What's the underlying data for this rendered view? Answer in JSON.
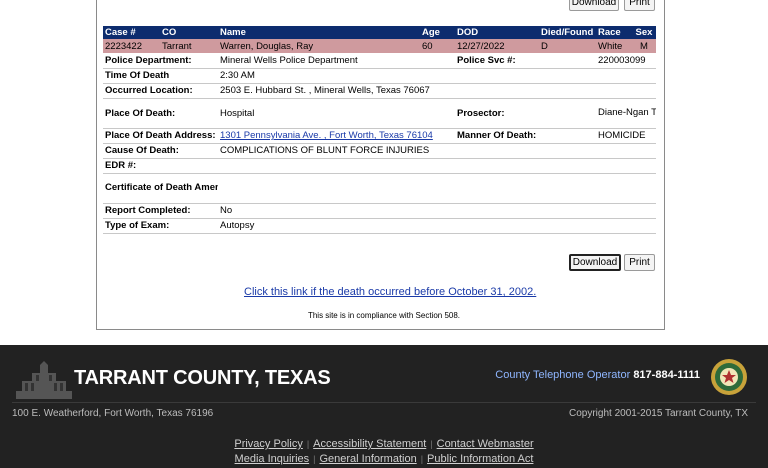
{
  "buttons": {
    "download": "Download",
    "print": "Print"
  },
  "table": {
    "headers": [
      "Case #",
      "CO",
      "Name",
      "Age",
      "DOD",
      "Died/Found",
      "Race",
      "Sex"
    ],
    "record": [
      "2223422",
      "Tarrant",
      "Warren, Douglas, Ray",
      "60",
      "12/27/2022",
      "D",
      "White",
      "M"
    ],
    "police_department": {
      "label": "Police Department:",
      "value": "Mineral Wells Police Department"
    },
    "police_svc": {
      "label": "Police Svc #:",
      "value": "220003099"
    },
    "time_of_death": {
      "label": "Time Of Death",
      "value": "2:30 AM"
    },
    "occurred_location": {
      "label": "Occurred Location:",
      "value": "2503 E. Hubbard St. , Mineral Wells, Texas 76067"
    },
    "place_of_death": {
      "label": "Place Of Death:",
      "value": "Hospital"
    },
    "prosector": {
      "label": "Prosector:",
      "value": "Diane-Ngan Trang, M.D."
    },
    "place_of_death_address": {
      "label": "Place Of Death Address:",
      "value": "1301 Pennsylvania Ave. , Fort Worth, Texas 76104"
    },
    "manner_of_death": {
      "label": "Manner Of Death:",
      "value": "HOMICIDE"
    },
    "cause_of_death": {
      "label": "Cause Of Death:",
      "value": "COMPLICATIONS OF BLUNT FORCE INJURIES"
    },
    "edr": {
      "label": "EDR #:",
      "value": ""
    },
    "certificate_amendment": {
      "label": "Certificate of Death Amendment:",
      "value": ""
    },
    "report_completed": {
      "label": "Report Completed:",
      "value": "No"
    },
    "type_of_exam": {
      "label": "Type of Exam:",
      "value": "Autopsy"
    }
  },
  "bottom_link": "Click this link if the death occurred before October 31, 2002.",
  "compliance": "This site is in compliance with Section 508.",
  "footer": {
    "brand": "TARRANT COUNTY, TEXAS",
    "phone_label": "County Telephone Operator",
    "phone_number": "817-884-1111",
    "address": "100 E. Weatherford, Fort Worth, Texas 76196",
    "copyright": "Copyright 2001-2015 Tarrant County, TX",
    "links_row1": [
      "Privacy Policy",
      "Accessibility Statement",
      "Contact Webmaster"
    ],
    "links_row2": [
      "Media Inquiries",
      "General Information",
      "Public Information Act"
    ]
  },
  "colors": {
    "header_bg": "#0d2c6e",
    "record_bg": "#cf9a9e",
    "footer_bg": "#222222",
    "link": "#1a3aa8"
  }
}
